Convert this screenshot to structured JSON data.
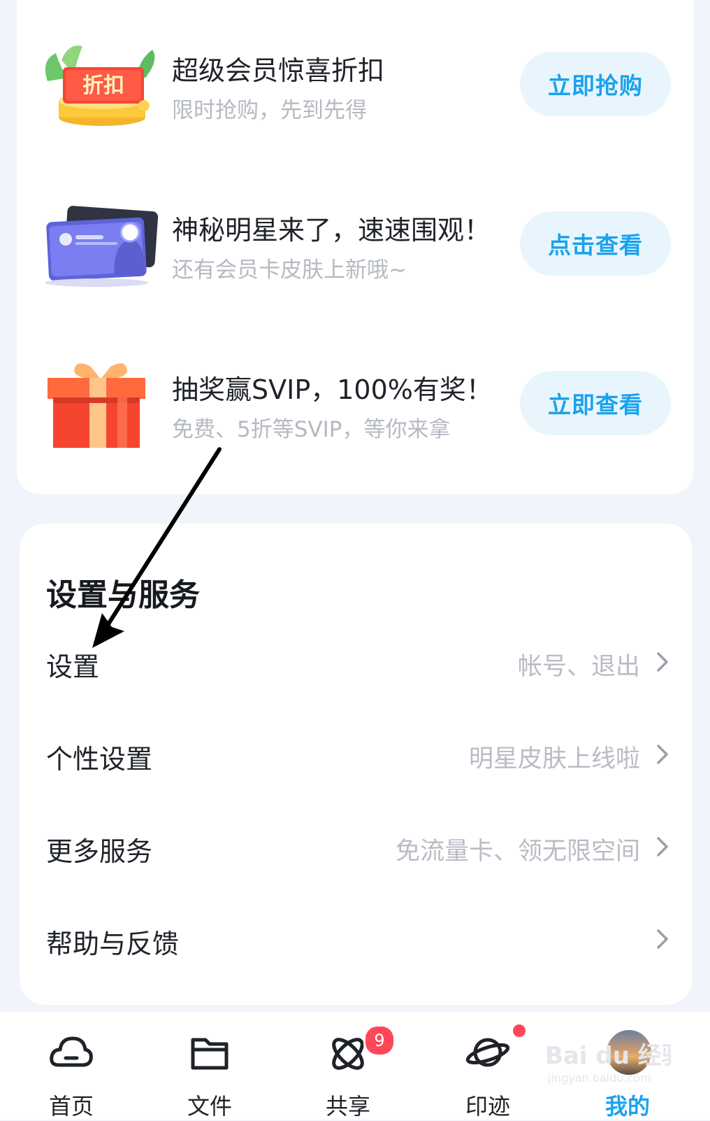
{
  "promos": [
    {
      "title": "超级会员惊喜折扣",
      "subtitle": "限时抢购，先到先得",
      "button": "立即抢购",
      "tag_text": "折扣"
    },
    {
      "title": "神秘明星来了，速速围观！",
      "subtitle": "还有会员卡皮肤上新哦~",
      "button": "点击查看"
    },
    {
      "title": "抽奖赢SVIP，100%有奖！",
      "subtitle": "免费、5折等SVIP，等你来拿",
      "button": "立即查看"
    }
  ],
  "services": {
    "title": "设置与服务",
    "items": [
      {
        "label": "设置",
        "hint": "帐号、退出"
      },
      {
        "label": "个性设置",
        "hint": "明星皮肤上线啦"
      },
      {
        "label": "更多服务",
        "hint": "免流量卡、领无限空间"
      },
      {
        "label": "帮助与反馈",
        "hint": ""
      }
    ]
  },
  "tabbar": {
    "items": [
      {
        "label": "首页",
        "icon": "cloud-icon"
      },
      {
        "label": "文件",
        "icon": "folder-icon"
      },
      {
        "label": "共享",
        "icon": "share-orbit-icon",
        "badge": "9"
      },
      {
        "label": "印迹",
        "icon": "planet-icon",
        "dot": true
      },
      {
        "label": "我的",
        "icon": "avatar",
        "active": true
      }
    ]
  },
  "watermark": {
    "text": "Bai du 经验",
    "url": "jingyan.baidu.com"
  },
  "colors": {
    "accent": "#1aa2ee",
    "button_bg": "#e9f5fd",
    "badge": "#ff4757",
    "page_bg": "#f1f4fa"
  }
}
